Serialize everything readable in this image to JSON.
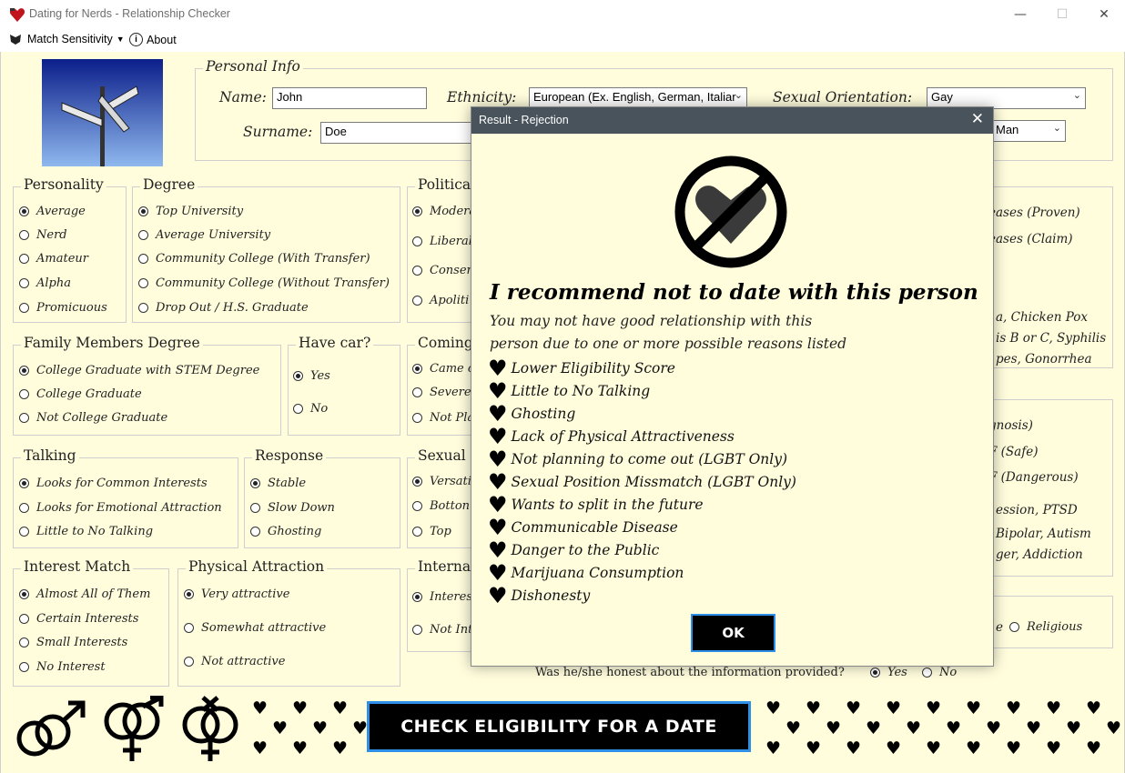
{
  "window": {
    "title": "Dating for Nerds - Relationship Checker",
    "min": "—",
    "max": "☐",
    "close": "✕"
  },
  "menu": {
    "match_sensitivity": "Match Sensitivity",
    "about": "About"
  },
  "personal_info": {
    "title": "Personal Info",
    "name_label": "Name:",
    "name_value": "John",
    "surname_label": "Surname:",
    "surname_value": "Doe",
    "ethnicity_label": "Ethnicity:",
    "ethnicity_value": "European (Ex. English, German, Italiar",
    "orientation_label": "Sexual Orientation:",
    "orientation_value": "Gay",
    "gender_value": "Man"
  },
  "personality": {
    "title": "Personality",
    "options": [
      "Average",
      "Nerd",
      "Amateur",
      "Alpha",
      "Promicuous"
    ]
  },
  "degree": {
    "title": "Degree",
    "options": [
      "Top University",
      "Average University",
      "Community College (With Transfer)",
      "Community College (Without Transfer)",
      "Drop Out / H.S. Graduate"
    ]
  },
  "political": {
    "title": "Politica",
    "options": [
      "Modera",
      "Liberal",
      "Conser",
      "Apoliti"
    ]
  },
  "family": {
    "title": "Family Members Degree",
    "options": [
      "College Graduate with STEM Degree",
      "College Graduate",
      "Not College Graduate"
    ]
  },
  "have_car": {
    "title": "Have car?",
    "options": [
      "Yes",
      "No"
    ]
  },
  "coming": {
    "title": "Coming",
    "options": [
      "Came c",
      "Severe",
      "Not Pla"
    ]
  },
  "talking": {
    "title": "Talking",
    "options": [
      "Looks for Common Interests",
      "Looks for Emotional Attraction",
      "Little to No Talking"
    ]
  },
  "response": {
    "title": "Response",
    "options": [
      "Stable",
      "Slow Down",
      "Ghosting"
    ]
  },
  "sexual": {
    "title": "Sexual P",
    "options": [
      "Versati",
      "Botton",
      "Top"
    ]
  },
  "interest": {
    "title": "Interest Match",
    "options": [
      "Almost All of Them",
      "Certain Interests",
      "Small Interests",
      "No Interest"
    ]
  },
  "physical": {
    "title": "Physical Attraction",
    "options": [
      "Very attractive",
      "Somewhat attractive",
      "Not attractive"
    ]
  },
  "internal": {
    "title": "Interna",
    "options": [
      "Interes",
      "Not Int"
    ]
  },
  "right_panel": {
    "disease": [
      "eases (Proven)",
      "eases (Claim)"
    ],
    "disease_text": [
      "a, Chicken Pox",
      "is B or C, Syphilis",
      "pes, Gonorrhea"
    ],
    "mental": [
      "gnosis)",
      "F (Safe)",
      "F (Dangerous)"
    ],
    "mental_text": [
      "ession, PTSD",
      "Bipolar, Autism",
      "ger, Addiction"
    ],
    "religion_partial": "e",
    "religion_opt": "Religious"
  },
  "honest": {
    "question": "Was he/she honest about the information provided?",
    "yes": "Yes",
    "no": "No"
  },
  "check_button": "CHECK ELIGIBILITY FOR A DATE",
  "dialog": {
    "title": "Result - Rejection",
    "close": "✕",
    "headline": "I recommend not to date with this person",
    "line1": "You may not have good relationship with this",
    "line2": "person due to one or more possible reasons listed",
    "reasons": [
      "Lower Eligibility Score",
      "Little to No Talking",
      "Ghosting",
      "Lack of Physical Attractiveness",
      "Not planning to come out (LGBT Only)",
      "Sexual Position Missmatch (LGBT Only)",
      "Wants to split in the future",
      "Communicable Disease",
      "Danger to the Public",
      "Marijuana Consumption",
      "Dishonesty"
    ],
    "ok": "OK"
  },
  "icons": {
    "heart_glyph": "♥",
    "ban_icon": "no-heart-icon",
    "colors": {
      "accent": "#2f8fe6",
      "bg": "#fffddc",
      "dialog_title": "#48535b"
    }
  }
}
